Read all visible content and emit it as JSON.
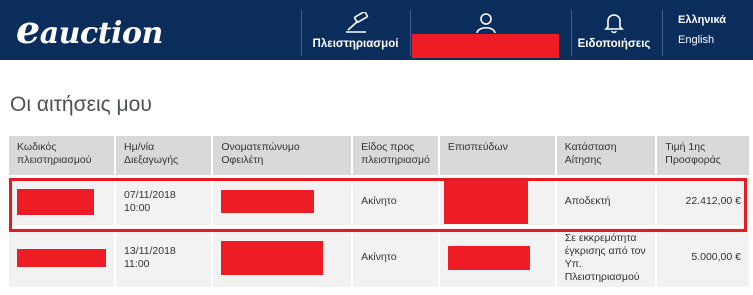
{
  "header": {
    "logo_e": "e",
    "logo_rest": "auction",
    "nav": {
      "auctions_label": "Πλειστηριασμοί",
      "notifications_label": "Ειδοποιήσεις"
    },
    "languages": [
      "Ελληνικά",
      "English"
    ]
  },
  "page": {
    "title": "Οι αιτήσεις μου"
  },
  "table": {
    "columns": [
      "Κωδικός πλειστηριασμού",
      "Ημ/νία Διεξαγωγής",
      "Ονοματεπώνυμο Οφειλέτη",
      "Είδος προς πλειστηριασμό",
      "Επισπεύδων",
      "Κατάσταση Αίτησης",
      "Τιμή 1ης Προσφοράς"
    ],
    "rows": [
      {
        "date": "07/11/2018",
        "time": "10:00",
        "type": "Ακίνητο",
        "status": "Αποδεκτή",
        "price": "22.412,00 €"
      },
      {
        "date": "13/11/2018",
        "time": "11:00",
        "type": "Ακίνητο",
        "status": "Σε εκκρεμότητα έγκρισης από τον Υπ. Πλειστηριασμού",
        "price": "5.000,00 €"
      }
    ]
  },
  "colors": {
    "nav_background": "#0a2d5c",
    "redaction": "#ee1c25",
    "highlight_border": "#e31b23"
  }
}
